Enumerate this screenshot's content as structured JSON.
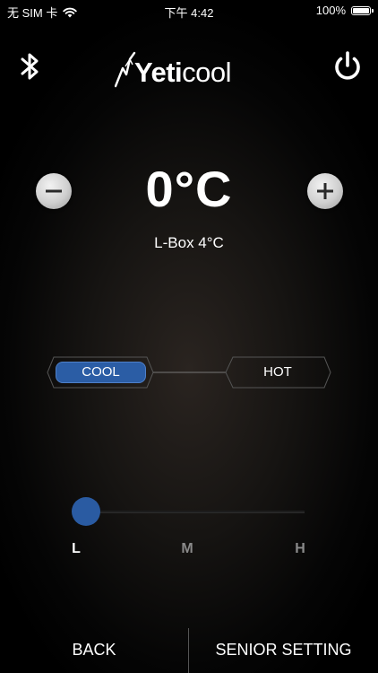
{
  "status_bar": {
    "carrier": "无 SIM 卡",
    "time": "下午 4:42",
    "battery": "100%"
  },
  "header": {
    "logo_bold": "Yeti",
    "logo_light": "cool",
    "bluetooth_icon": "bluetooth-icon",
    "power_icon": "power-icon"
  },
  "temperature": {
    "value": "0°C",
    "subtitle": "L-Box 4°C",
    "decrease_icon": "minus-icon",
    "increase_icon": "plus-icon"
  },
  "mode": {
    "cool_label": "COOL",
    "hot_label": "HOT",
    "selected": "COOL",
    "accent": "#2b5da5"
  },
  "level": {
    "labels": [
      "L",
      "M",
      "H"
    ],
    "selected": "L",
    "position": 0
  },
  "footer": {
    "back_label": "BACK",
    "senior_label": "SENIOR SETTING"
  }
}
